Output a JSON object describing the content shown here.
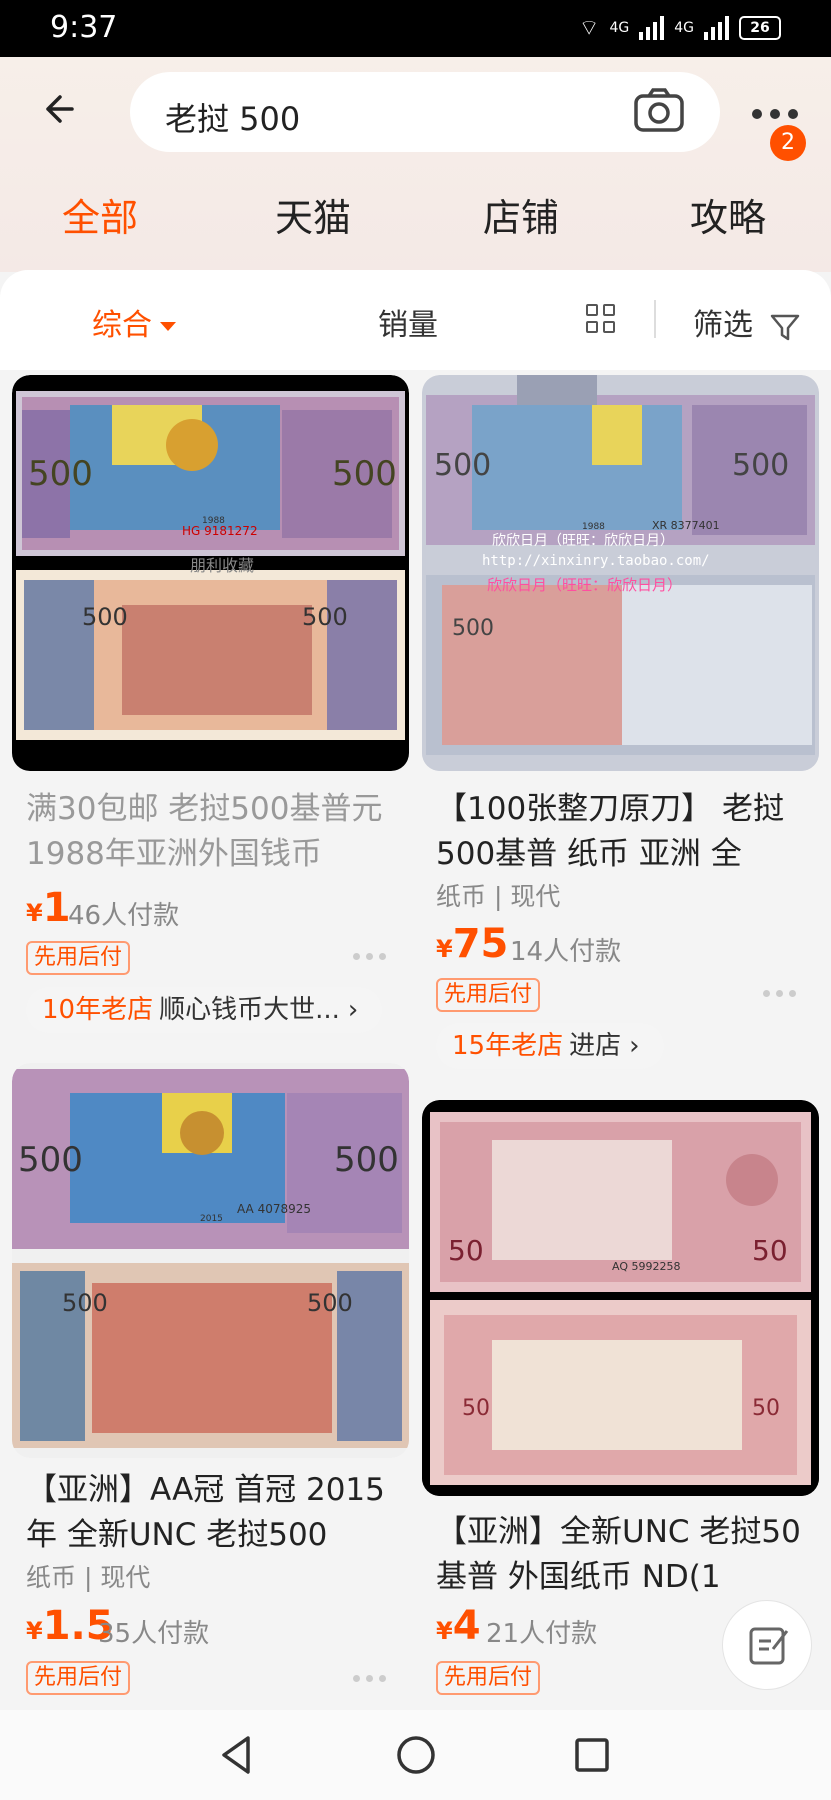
{
  "status_bar": {
    "time": "9:37",
    "net1": "4G",
    "net2": "4G",
    "battery": "26"
  },
  "search": {
    "query": "老挝 500",
    "badge_count": "2"
  },
  "tabs": [
    {
      "label": "全部"
    },
    {
      "label": "天猫"
    },
    {
      "label": "店铺"
    },
    {
      "label": "攻略"
    }
  ],
  "sort": {
    "overall": "综合",
    "sales": "销量",
    "filter": "筛选"
  },
  "products": [
    {
      "title": "满30包邮 老挝500基普元1988年亚洲外国钱币",
      "price_symbol": "¥",
      "price": "1",
      "sales": "46人付款",
      "tag": "先用后付",
      "shop_age": "10年老店",
      "shop_name": "顺心钱币大世...",
      "note_top_serial": "HG 9181272",
      "note_year": "1988",
      "note_value": "500",
      "watermark": "朋利收藏"
    },
    {
      "title": "【100张整刀原刀】 老挝500基普 纸币 亚洲 全",
      "category": "纸币 | 现代",
      "price_symbol": "¥",
      "price": "75",
      "sales": "14人付款",
      "tag": "先用后付",
      "shop_age": "15年老店",
      "shop_name": "进店",
      "note_top_serial": "XR 8377401",
      "note_year": "1988",
      "note_value": "500",
      "overlay_1": "欣欣日月（旺旺：欣欣日月）",
      "overlay_2": "http://xinxinry.taobao.com/",
      "overlay_3": "欣欣日月（旺旺：欣欣日月）"
    },
    {
      "title": "【亚洲】AA冠 首冠 2015年 全新UNC 老挝500",
      "category": "纸币 | 现代",
      "price_symbol": "¥",
      "price": "1.5",
      "sales": "35人付款",
      "tag": "先用后付",
      "note_top_serial": "AA 4078925",
      "note_year": "2015",
      "note_value": "500"
    },
    {
      "title": "【亚洲】全新UNC 老挝50基普 外国纸币 ND(1",
      "price_symbol": "¥",
      "price": "4",
      "sales": "21人付款",
      "tag": "先用后付",
      "note_top_serial": "AQ 5992258",
      "note_value": "50"
    }
  ],
  "colors": {
    "accent": "#ff5000",
    "tag_border": "#ff9a70"
  }
}
